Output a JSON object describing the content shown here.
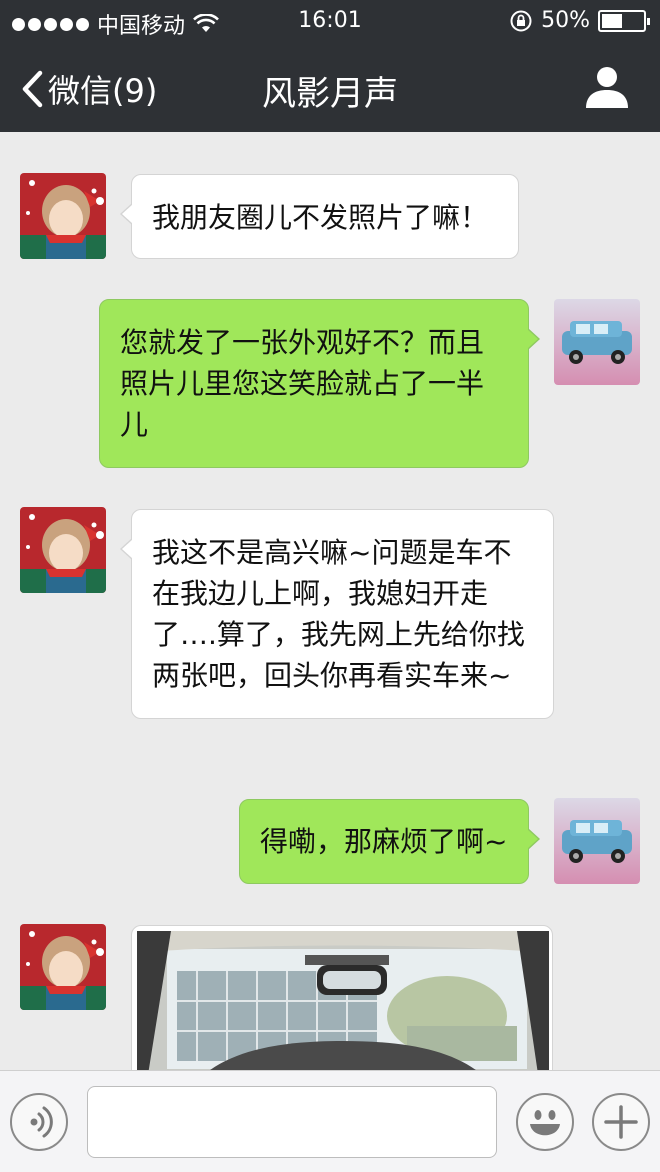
{
  "status_bar": {
    "carrier": "中国移动",
    "time": "16:01",
    "battery": "50%",
    "battery_level": 0.5
  },
  "nav": {
    "back_label": "微信(9)",
    "title": "风影月声"
  },
  "messages": [
    {
      "side": "in",
      "text": "我朋友圈儿不发照片了嘛！"
    },
    {
      "side": "out",
      "text": "您就发了一张外观好不？而且照片儿里您这笑脸就占了一半儿"
    },
    {
      "side": "in",
      "text": "我这不是高兴嘛~问题是车不在我边儿上啊，我媳妇开走了….算了，我先网上先给你找两张吧，回头你再看实车来~"
    },
    {
      "side": "out",
      "text": "得嘞，那麻烦了啊~"
    },
    {
      "side": "in",
      "type": "image"
    }
  ],
  "input": {
    "value": "",
    "placeholder": ""
  },
  "colors": {
    "nav_bg": "#2e3135",
    "chat_bg": "#ebebeb",
    "bubble_out": "#a0e75a",
    "bubble_in": "#ffffff"
  }
}
